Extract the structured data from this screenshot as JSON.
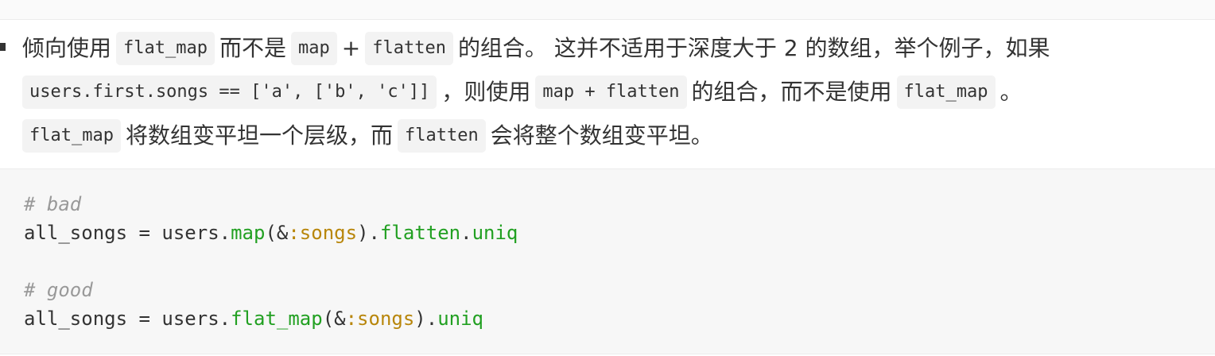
{
  "paragraph": {
    "s1": "倾向使用",
    "c1": "flat_map",
    "s2": "而不是",
    "c2": "map",
    "s3": "+",
    "c3": "flatten",
    "s4": "的组合。 这并不适用于深度大于 2 的数组，举个例子，如果",
    "c4": "users.first.songs == ['a', ['b', 'c']]",
    "s5": "，则使用",
    "c5": "map + flatten",
    "s6": "的组合，而不是使用",
    "c6": "flat_map",
    "s7": "。",
    "c7": "flat_map",
    "s8": "将数组变平坦一个层级，而",
    "c8": "flatten",
    "s9": "会将整个数组变平坦。"
  },
  "code": {
    "line1": {
      "comment": "# bad"
    },
    "line2": {
      "a": "all_songs = users.",
      "b": "map",
      "c": "(&",
      "d": ":songs",
      "e": ").",
      "f": "flatten",
      "g": ".",
      "h": "uniq"
    },
    "line4": {
      "comment": "# good"
    },
    "line5": {
      "a": "all_songs = users.",
      "b": "flat_map",
      "c": "(&",
      "d": ":songs",
      "e": ").",
      "f": "uniq"
    }
  }
}
